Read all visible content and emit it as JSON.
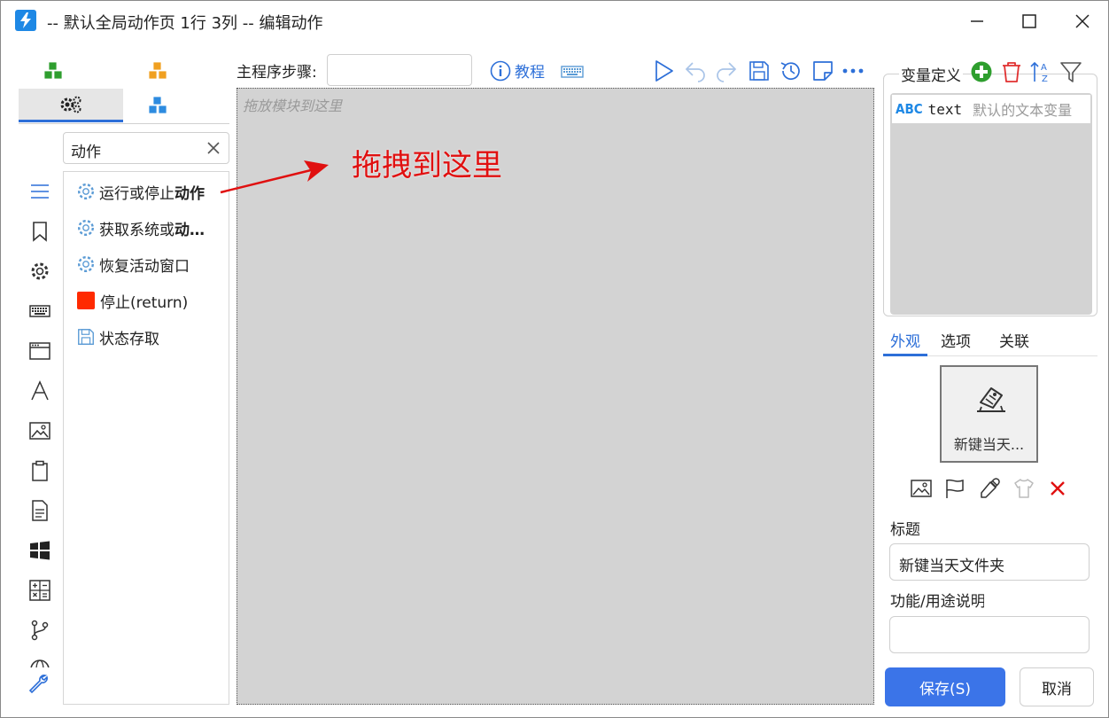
{
  "window": {
    "title": "-- 默认全局动作页 1行 3列 -- 编辑动作",
    "controls": [
      "minimize-icon",
      "maximize-icon",
      "close-icon"
    ]
  },
  "left": {
    "category_tabs": [
      {
        "icon": "green-cubes-icon",
        "color": "#2e9e2e"
      },
      {
        "icon": "orange-cubes-icon",
        "color": "#f0a020"
      },
      {
        "icon": "gears-icon",
        "color": "#222222",
        "active": true
      },
      {
        "icon": "blue-cubes-icon",
        "color": "#2d8be0"
      }
    ],
    "search": {
      "value": "动作"
    },
    "sidebar_icons": [
      "list-icon",
      "bookmark-icon",
      "gear-icon",
      "keyboard-icon",
      "window-icon",
      "font-icon",
      "image-icon",
      "clipboard-icon",
      "document-icon",
      "windows-icon",
      "calculator-icon",
      "branch-icon",
      "globe-icon",
      "wrench-icon"
    ],
    "actions": [
      {
        "prefix": "运行或停止",
        "bold": "动作",
        "icon": "gear-icon"
      },
      {
        "prefix": "获取系统或",
        "bold": "动…",
        "icon": "gear-icon"
      },
      {
        "prefix": "恢复活动窗口",
        "bold": "",
        "icon": "gear-icon"
      },
      {
        "prefix": "停止(return)",
        "bold": "",
        "icon": "stop-square-icon"
      },
      {
        "prefix": "状态存取",
        "bold": "",
        "icon": "save-icon"
      }
    ]
  },
  "center": {
    "step_label": "主程序步骤:",
    "step_value": "",
    "tutorial_label": "教程",
    "toolbar_icons": [
      "play-icon",
      "undo-icon",
      "redo-icon",
      "save-icon",
      "history-icon",
      "note-icon",
      "more-icon"
    ],
    "canvas_hint": "拖放模块到这里",
    "annotation": "拖拽到这里",
    "accent": "#2d6fd8"
  },
  "right": {
    "var_header": "变量定义",
    "var_icons": [
      "add-icon",
      "delete-icon",
      "sort-az-icon",
      "filter-icon"
    ],
    "variables": [
      {
        "type": "ABC",
        "name": "text",
        "desc": "默认的文本变量"
      }
    ],
    "tabs": [
      "外观",
      "选项",
      "关联"
    ],
    "preview_caption": "新键当天...",
    "appearance_icons": [
      "image-icon",
      "flag-icon",
      "eyedropper-icon",
      "shirt-icon",
      "remove-icon"
    ],
    "title_label": "标题",
    "title_value": "新键当天文件夹",
    "desc_label": "功能/用途说明",
    "desc_value": "",
    "save_label": "保存(S)",
    "cancel_label": "取消"
  }
}
